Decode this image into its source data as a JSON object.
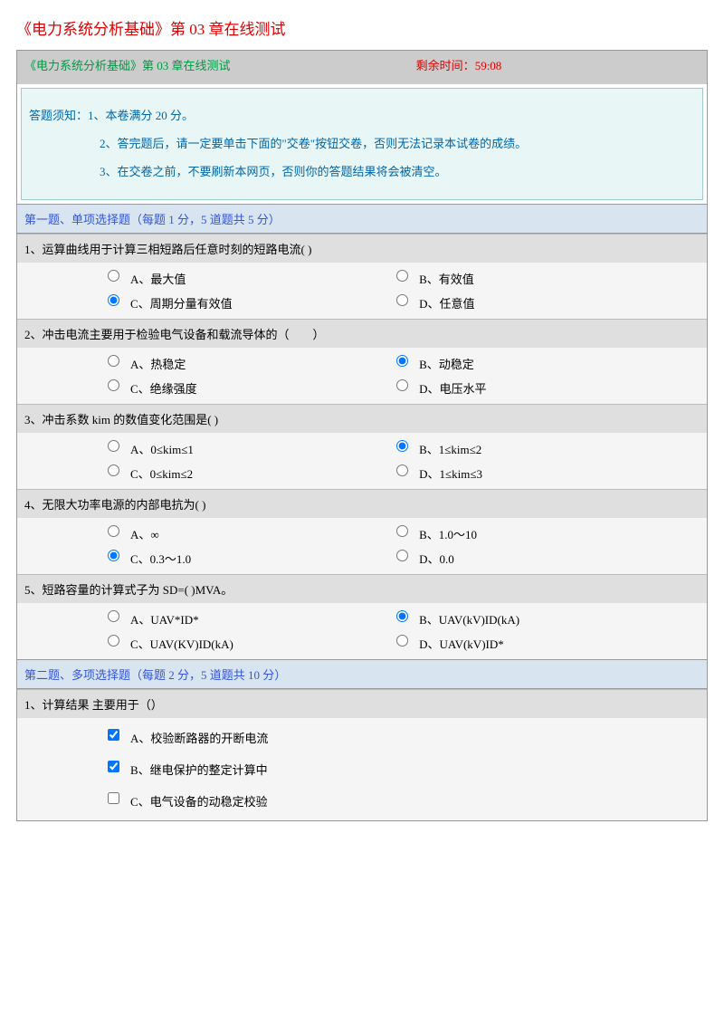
{
  "pageTitle": "《电力系统分析基础》第 03 章在线测试",
  "header": {
    "titleText": "《电力系统分析基础》第 03 章在线测试",
    "timerLabel": "剩余时间：",
    "timerValue": "59:08"
  },
  "instructions": {
    "line1": "答题须知：1、本卷满分 20 分。",
    "line2": "2、答完题后，请一定要单击下面的\"交卷\"按钮交卷，否则无法记录本试卷的成绩。",
    "line3": "3、在交卷之前，不要刷新本网页，否则你的答题结果将会被清空。"
  },
  "section1": {
    "header": "第一题、单项选择题（每题 1 分，5 道题共 5 分）",
    "q1": {
      "text": "1、运算曲线用于计算三相短路后任意时刻的短路电流( )",
      "optA": "A、最大值",
      "optB": "B、有效值",
      "optC": "C、周期分量有效值",
      "optD": "D、任意值",
      "selected": "C"
    },
    "q2": {
      "text": "2、冲击电流主要用于检验电气设备和载流导体的（　　）",
      "optA": "A、热稳定",
      "optB": "B、动稳定",
      "optC": "C、绝缘强度",
      "optD": "D、电压水平",
      "selected": "B"
    },
    "q3": {
      "text": "3、冲击系数 kim 的数值变化范围是( )",
      "optA": "A、0≤kim≤1",
      "optB": "B、1≤kim≤2",
      "optC": "C、0≤kim≤2",
      "optD": "D、1≤kim≤3",
      "selected": "B"
    },
    "q4": {
      "text": "4、无限大功率电源的内部电抗为( )",
      "optA": "A、∞",
      "optB": "B、1.0～10",
      "optC": "C、0.3～1.0",
      "optD": "D、0.0",
      "selected": "C"
    },
    "q5": {
      "text": "5、短路容量的计算式子为 SD=( )MVA。",
      "optA": "A、UAV*ID*",
      "optB": "B、UAV(kV)ID(kA)",
      "optC": "C、UAV(KV)ID(kA)",
      "optD": "D、UAV(kV)ID*",
      "selected": "B"
    }
  },
  "section2": {
    "header": "第二题、多项选择题（每题 2 分，5 道题共 10 分）",
    "q1": {
      "text": "1、计算结果 主要用于（）",
      "optA": "A、校验断路器的开断电流",
      "optB": "B、继电保护的整定计算中",
      "optC": "C、电气设备的动稳定校验",
      "checkedA": true,
      "checkedB": true,
      "checkedC": false
    }
  }
}
